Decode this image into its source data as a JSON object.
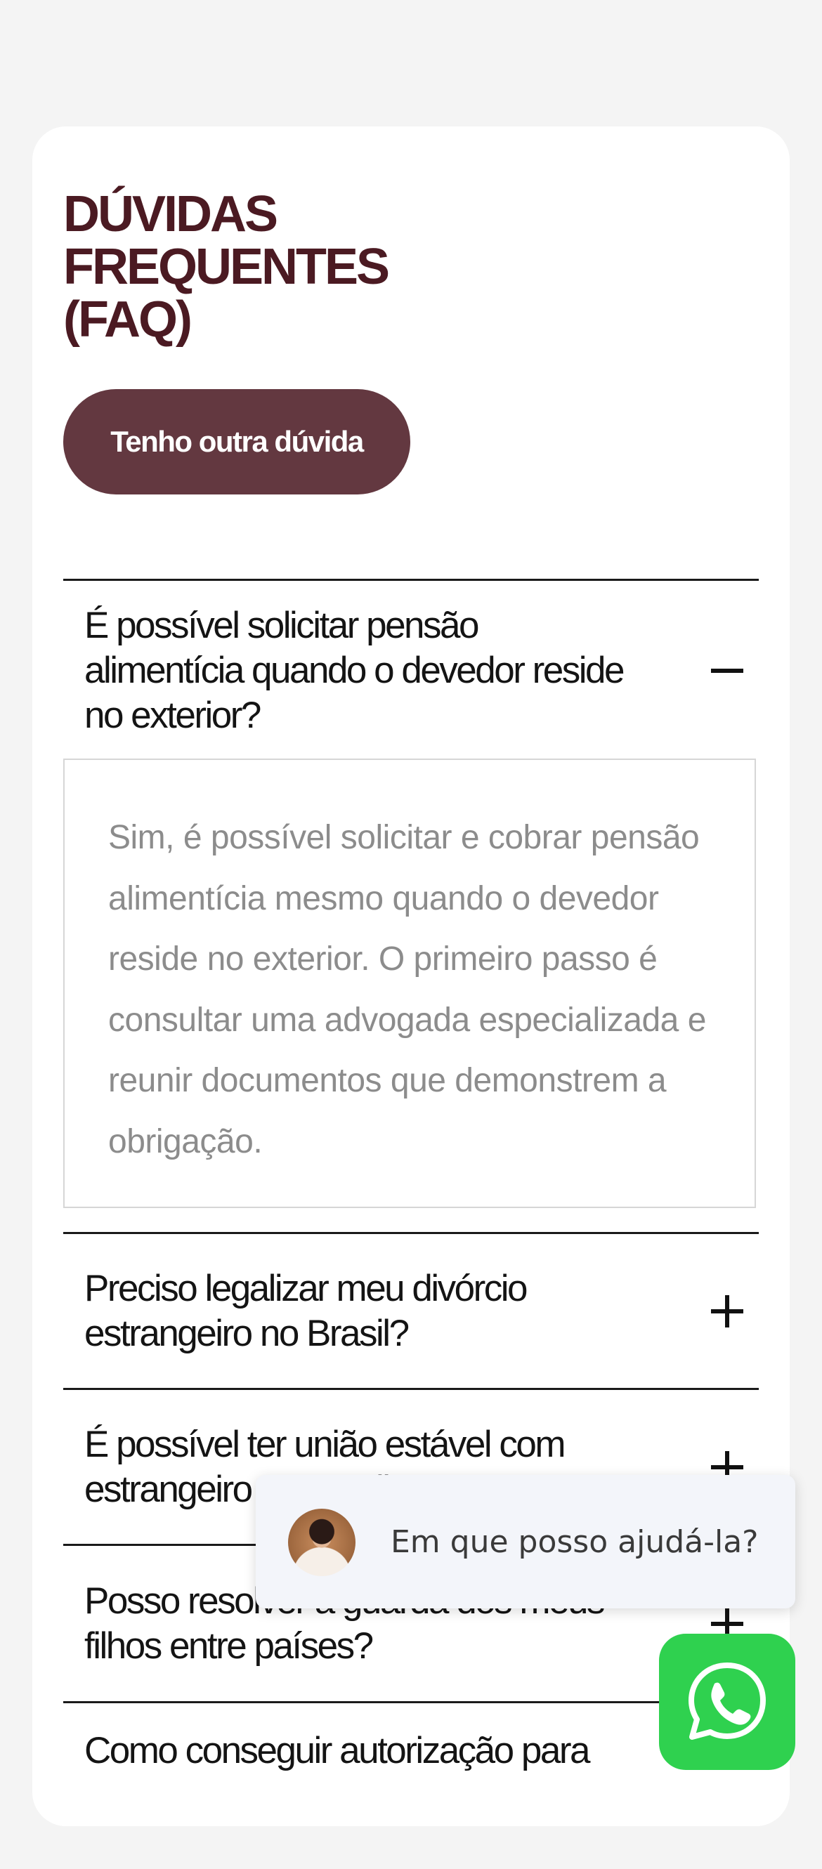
{
  "faq": {
    "title": "DÚVIDAS\nFREQUENTES\n(FAQ)",
    "cta_label": "Tenho outra dúvida",
    "items": [
      {
        "question": "É possível solicitar pensão alimentícia quando o devedor reside no exterior?",
        "expanded": true,
        "answer": "Sim, é possível solicitar e cobrar pensão alimentícia mesmo quando o devedor reside no exterior. O primeiro passo é consultar uma advogada especializada e reunir documentos que demonstrem a obrigação."
      },
      {
        "question": "Preciso legalizar meu divórcio estrangeiro no Brasil?",
        "expanded": false
      },
      {
        "question": "É possível ter união estável com estrangeiro no Brasil?",
        "expanded": false
      },
      {
        "question": "Posso resolver a guarda dos meus filhos entre países?",
        "expanded": false
      },
      {
        "question": "Como conseguir autorização para",
        "expanded": false
      }
    ]
  },
  "chat_widget": {
    "message": "Em que posso ajudá-la?",
    "avatar_icon": "person-avatar",
    "button_icon": "whatsapp-icon",
    "button_color": "#2fd14f"
  },
  "colors": {
    "title": "#4b1a22",
    "cta_background": "#633840"
  }
}
